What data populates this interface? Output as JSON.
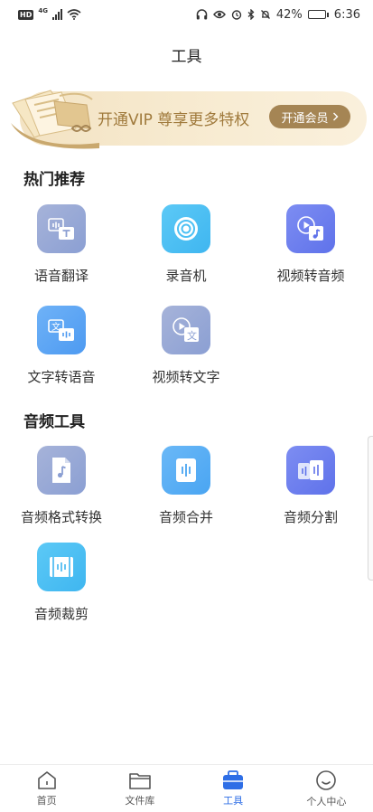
{
  "status_bar": {
    "hd": "HD",
    "network": "4G",
    "battery": "42%",
    "battery_level": 0.42,
    "time": "6:36"
  },
  "header": {
    "title": "工具"
  },
  "vip_banner": {
    "text": "开通VIP 尊享更多特权",
    "button_label": "开通会员"
  },
  "sections": [
    {
      "title": "热门推荐",
      "tools": [
        {
          "label": "语音翻译",
          "icon": "voice-translate-icon",
          "color": "#9aa9d8"
        },
        {
          "label": "录音机",
          "icon": "recorder-icon",
          "color": "#4cc0f4"
        },
        {
          "label": "视频转音频",
          "icon": "video-to-audio-icon",
          "color": "#6d7fee"
        },
        {
          "label": "文字转语音",
          "icon": "text-to-speech-icon",
          "color": "#5ea6f4"
        },
        {
          "label": "视频转文字",
          "icon": "video-to-text-icon",
          "color": "#9aa9d8"
        }
      ]
    },
    {
      "title": "音频工具",
      "tools": [
        {
          "label": "音频格式转换",
          "icon": "audio-format-convert-icon",
          "color": "#9aa9d8"
        },
        {
          "label": "音频合并",
          "icon": "audio-merge-icon",
          "color": "#5ea6f4"
        },
        {
          "label": "音频分割",
          "icon": "audio-split-icon",
          "color": "#6d7fee"
        },
        {
          "label": "音频裁剪",
          "icon": "audio-trim-icon",
          "color": "#4cb4f4"
        }
      ]
    }
  ],
  "bottom_nav": [
    {
      "label": "首页",
      "icon": "home-icon",
      "active": false
    },
    {
      "label": "文件库",
      "icon": "folder-icon",
      "active": false
    },
    {
      "label": "工具",
      "icon": "toolbox-icon",
      "active": true
    },
    {
      "label": "个人中心",
      "icon": "smiley-icon",
      "active": false
    }
  ],
  "colors": {
    "accent": "#2e6ee6",
    "vip_gold": "#a58554"
  }
}
